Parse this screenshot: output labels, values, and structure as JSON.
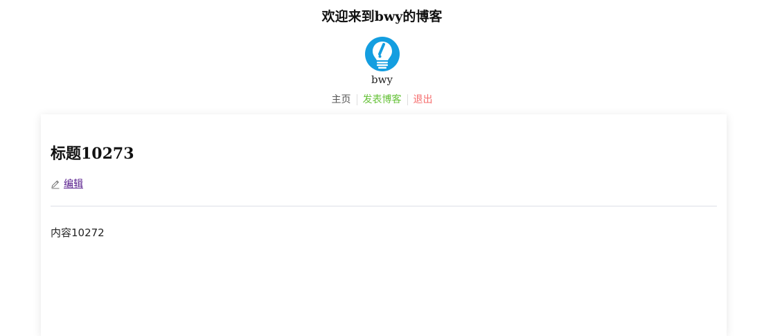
{
  "header": {
    "site_title": "欢迎来到bwy的博客",
    "avatar_icon": "lightbulb-icon",
    "username": "bwy"
  },
  "nav": {
    "home_label": "主页",
    "publish_label": "发表博客",
    "logout_label": "退出"
  },
  "post": {
    "title": "标题10273",
    "edit_icon": "pencil-icon",
    "edit_label": "编辑",
    "content": "内容10272"
  },
  "colors": {
    "avatar_blue": "#149ee0",
    "publish_green": "#67c23a",
    "logout_red": "#f56c6c",
    "link_purple": "#551a8b"
  }
}
